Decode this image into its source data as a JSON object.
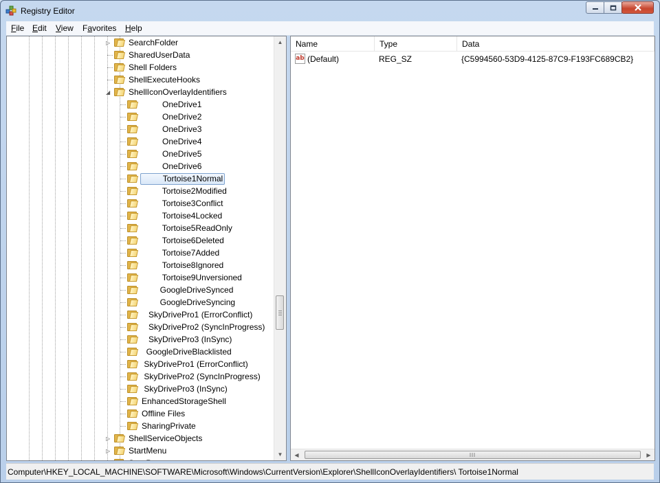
{
  "window": {
    "title": "Registry Editor",
    "icon": "registry-editor-icon",
    "controls": {
      "minimize": "minimize-icon",
      "maximize": "maximize-icon",
      "close": "close-icon"
    }
  },
  "menu": [
    {
      "name": "file",
      "label": "File",
      "accel": "F",
      "rest": "ile"
    },
    {
      "name": "edit",
      "label": "Edit",
      "accel": "E",
      "rest": "dit"
    },
    {
      "name": "view",
      "label": "View",
      "accel": "V",
      "rest": "iew"
    },
    {
      "name": "favorites",
      "label": "Favorites",
      "accel": "a",
      "pre": "F",
      "rest": "vorites"
    },
    {
      "name": "help",
      "label": "Help",
      "accel": "H",
      "rest": "elp"
    }
  ],
  "tree": [
    {
      "label": "SearchFolder",
      "expander": "collapsed"
    },
    {
      "label": "SharedUserData",
      "expander": "none"
    },
    {
      "label": "Shell Folders",
      "expander": "none"
    },
    {
      "label": "ShellExecuteHooks",
      "expander": "none"
    },
    {
      "label": "ShellIconOverlayIdentifiers",
      "expander": "expanded"
    },
    {
      "label": "         OneDrive1"
    },
    {
      "label": "         OneDrive2"
    },
    {
      "label": "         OneDrive3"
    },
    {
      "label": "         OneDrive4"
    },
    {
      "label": "         OneDrive5"
    },
    {
      "label": "         OneDrive6"
    },
    {
      "label": "         Tortoise1Normal",
      "selected": true
    },
    {
      "label": "         Tortoise2Modified"
    },
    {
      "label": "         Tortoise3Conflict"
    },
    {
      "label": "         Tortoise4Locked"
    },
    {
      "label": "         Tortoise5ReadOnly"
    },
    {
      "label": "         Tortoise6Deleted"
    },
    {
      "label": "         Tortoise7Added"
    },
    {
      "label": "         Tortoise8Ignored"
    },
    {
      "label": "         Tortoise9Unversioned"
    },
    {
      "label": "        GoogleDriveSynced"
    },
    {
      "label": "        GoogleDriveSyncing"
    },
    {
      "label": "   SkyDrivePro1 (ErrorConflict)"
    },
    {
      "label": "   SkyDrivePro2 (SyncInProgress)"
    },
    {
      "label": "   SkyDrivePro3 (InSync)"
    },
    {
      "label": "  GoogleDriveBlacklisted"
    },
    {
      "label": " SkyDrivePro1 (ErrorConflict)"
    },
    {
      "label": " SkyDrivePro2 (SyncInProgress)"
    },
    {
      "label": " SkyDrivePro3 (InSync)"
    },
    {
      "label": "EnhancedStorageShell"
    },
    {
      "label": "Offline Files"
    },
    {
      "label": "SharingPrivate"
    },
    {
      "label": "ShellServiceObjects",
      "expander": "collapsed",
      "level": 0
    },
    {
      "label": "StartMenu",
      "expander": "collapsed",
      "level": 0
    },
    {
      "label": "StartPage",
      "expander": "collapsed",
      "level": 0,
      "partial": true
    }
  ],
  "list": {
    "columns": [
      "Name",
      "Type",
      "Data"
    ],
    "rows": [
      {
        "name": "(Default)",
        "type": "REG_SZ",
        "data": "{C5994560-53D9-4125-87C9-F193FC689CB2}",
        "icon": "string-value-icon"
      }
    ]
  },
  "status": {
    "path": "Computer\\HKEY_LOCAL_MACHINE\\SOFTWARE\\Microsoft\\Windows\\CurrentVersion\\Explorer\\ShellIconOverlayIdentifiers\\         Tortoise1Normal"
  }
}
